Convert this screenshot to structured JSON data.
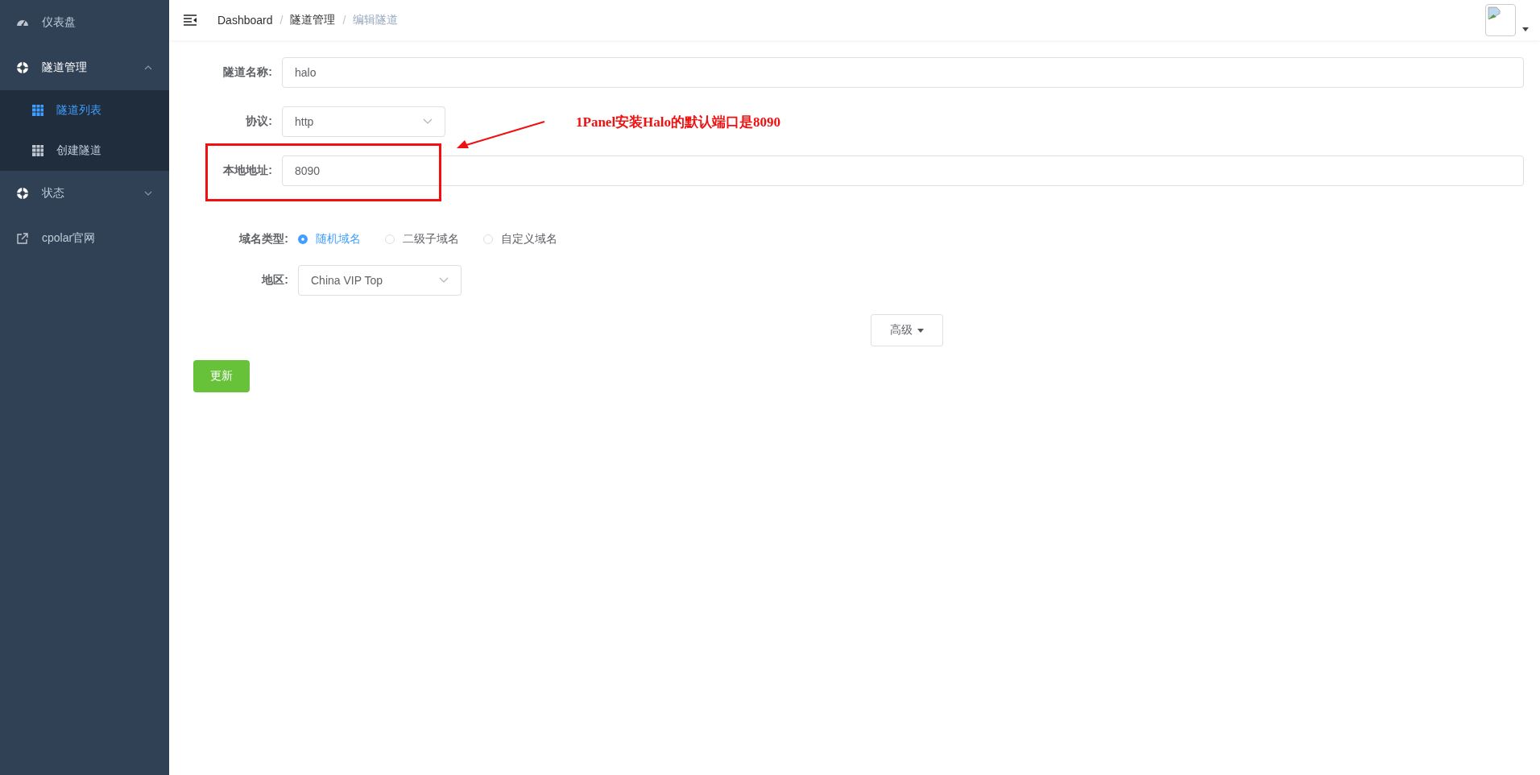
{
  "sidebar": {
    "items": [
      {
        "kind": "link",
        "label": "仪表盘"
      },
      {
        "kind": "group",
        "label": "隧道管理",
        "expanded": true,
        "children": [
          {
            "label": "隧道列表",
            "selected": true
          },
          {
            "label": "创建隧道",
            "selected": false
          }
        ]
      },
      {
        "kind": "group",
        "label": "状态",
        "expanded": false
      },
      {
        "kind": "external",
        "label": "cpolar官网"
      }
    ]
  },
  "breadcrumb": [
    {
      "kind": "link",
      "text": "Dashboard"
    },
    {
      "kind": "separator",
      "text": "/"
    },
    {
      "kind": "link",
      "text": "隧道管理"
    },
    {
      "kind": "separator",
      "text": "/"
    },
    {
      "kind": "current",
      "text": "编辑隧道"
    }
  ],
  "form": {
    "name": {
      "label": "隧道名称:",
      "value": "halo"
    },
    "protocol": {
      "label": "协议:",
      "value": "http"
    },
    "local_address": {
      "label": "本地地址:",
      "value": "8090"
    },
    "domain_type": {
      "label": "域名类型:",
      "options": [
        {
          "label": "随机域名",
          "selected": true
        },
        {
          "label": "二级子域名",
          "selected": false
        },
        {
          "label": "自定义域名",
          "selected": false
        }
      ]
    },
    "region": {
      "label": "地区:",
      "value": "China VIP Top"
    },
    "advanced_button": "高级",
    "submit_button": "更新"
  },
  "annotation": {
    "text": "1Panel安装Halo的默认端口是8090"
  }
}
